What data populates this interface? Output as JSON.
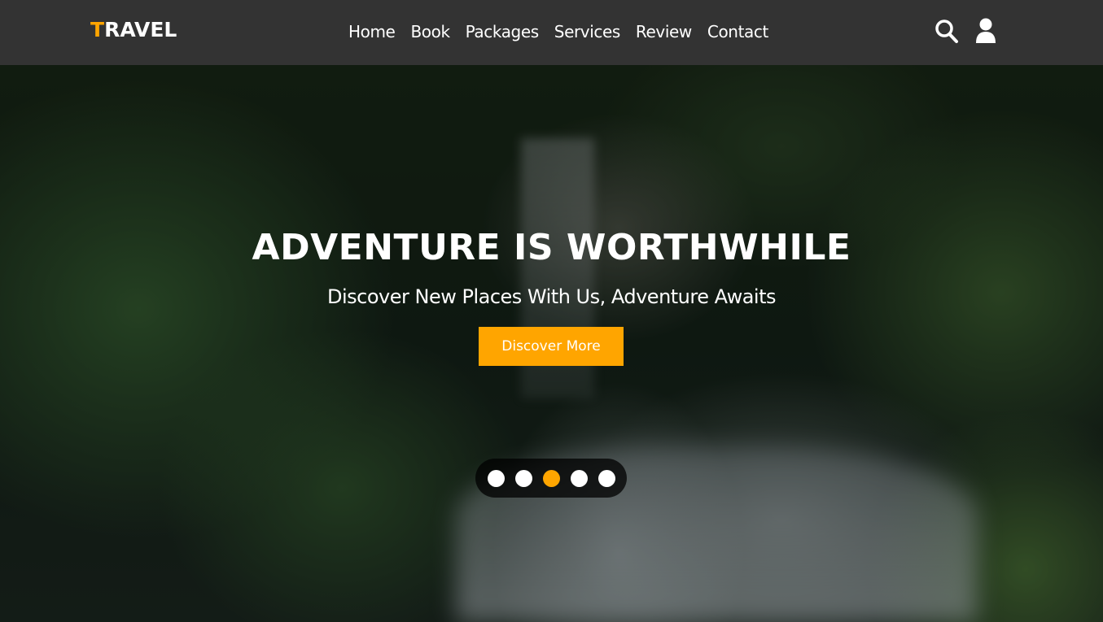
{
  "header": {
    "logo_first": "T",
    "logo_rest": "RAVEL",
    "nav": [
      {
        "label": "Home"
      },
      {
        "label": "Book"
      },
      {
        "label": "Packages"
      },
      {
        "label": "Services"
      },
      {
        "label": "Review"
      },
      {
        "label": "Contact"
      }
    ],
    "icons": [
      "search-icon",
      "user-icon"
    ]
  },
  "hero": {
    "title": "ADVENTURE IS WORTHWHILE",
    "subtitle": "Discover New Places With Us, Adventure Awaits",
    "button_label": "Discover More",
    "slides": 5,
    "active_slide": 3
  },
  "colors": {
    "accent": "#ffa500",
    "header_bg": "#333333",
    "text": "#ffffff"
  }
}
